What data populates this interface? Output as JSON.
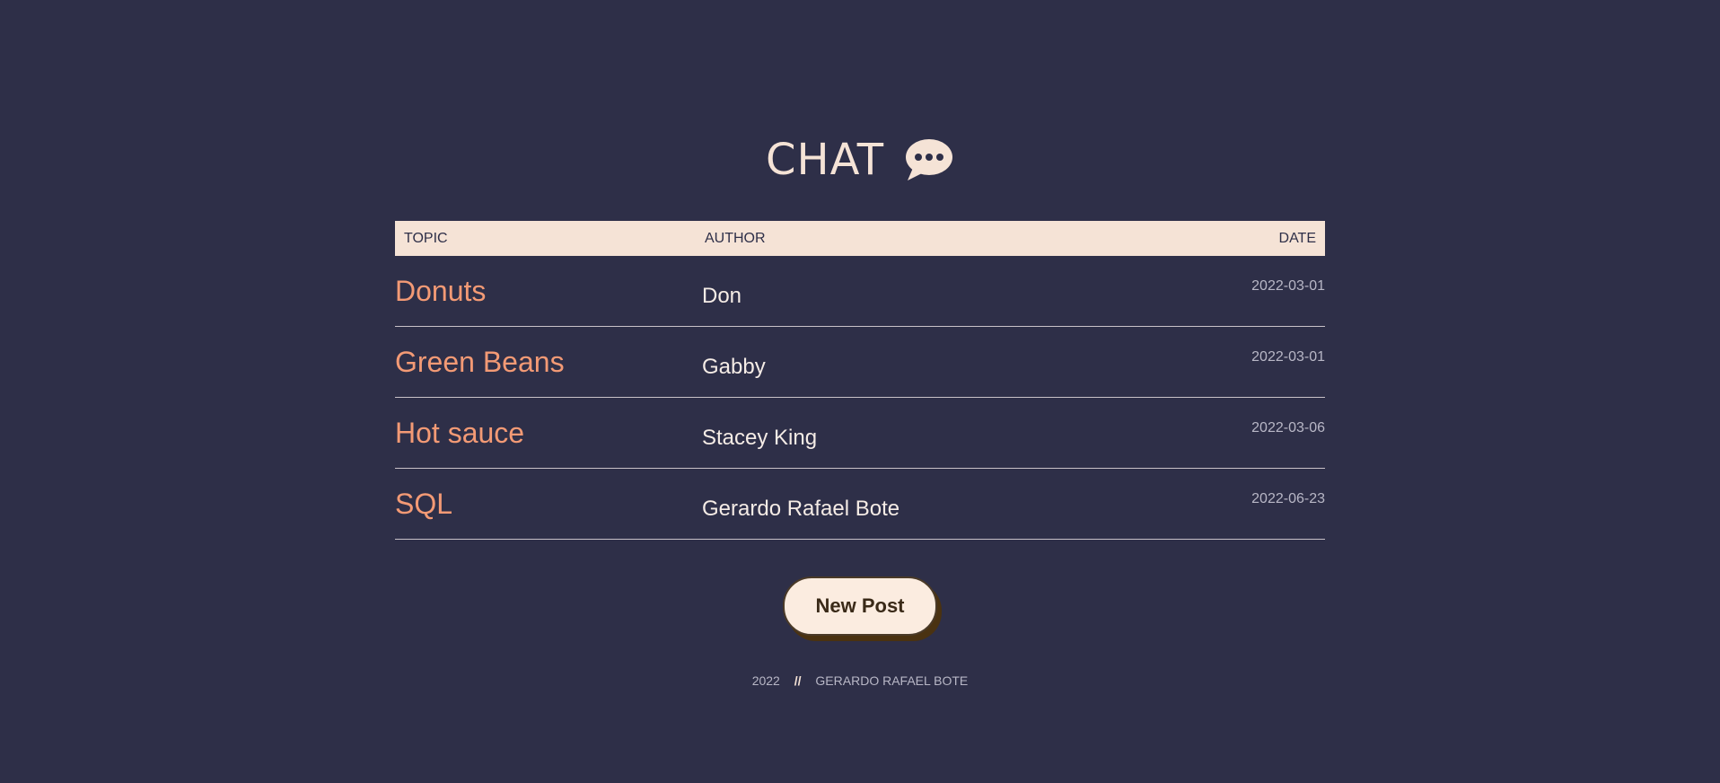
{
  "header": {
    "title": "CHAT",
    "icon": "chat-bubble-icon"
  },
  "table": {
    "columns": {
      "topic": "TOPIC",
      "author": "AUTHOR",
      "date": "DATE"
    },
    "rows": [
      {
        "topic": "Donuts",
        "author": "Don",
        "date": "2022-03-01"
      },
      {
        "topic": "Green Beans",
        "author": "Gabby",
        "date": "2022-03-01"
      },
      {
        "topic": "Hot sauce",
        "author": "Stacey King",
        "date": "2022-03-06"
      },
      {
        "topic": "SQL",
        "author": "Gerardo Rafael Bote",
        "date": "2022-06-23"
      }
    ]
  },
  "actions": {
    "new_post_label": "New Post"
  },
  "footer": {
    "year": "2022",
    "separator": "//",
    "author": "GERARDO RAFAEL BOTE"
  },
  "colors": {
    "background": "#2e2f48",
    "header_bar": "#f5e3d6",
    "topic_link": "#f39a75",
    "button_bg": "#fbece0",
    "button_shadow": "#4a3211"
  }
}
